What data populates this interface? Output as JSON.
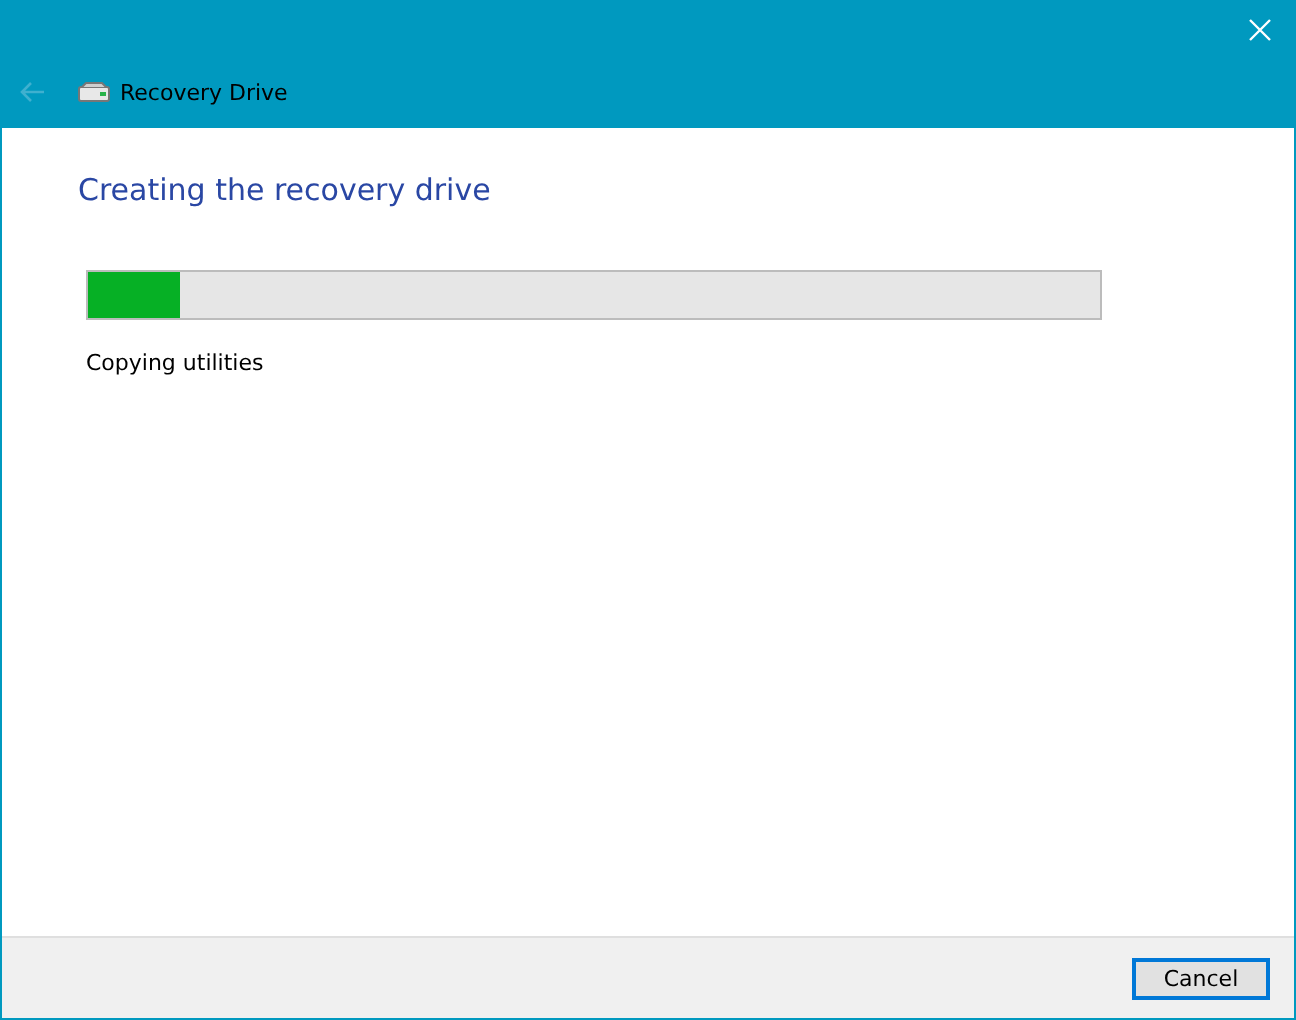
{
  "window": {
    "title": "Recovery Drive",
    "back_disabled": true
  },
  "heading": "Creating the recovery drive",
  "progress": {
    "level": 0.09,
    "status": "Copying utilities"
  },
  "buttons": [
    {
      "label": "Cancel",
      "focused": true
    }
  ]
}
